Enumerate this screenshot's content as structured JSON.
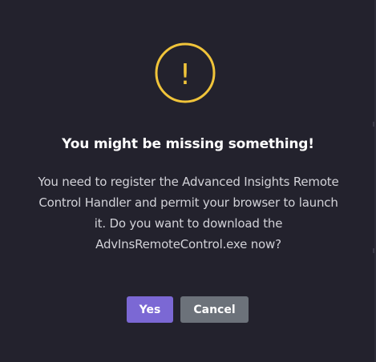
{
  "dialog": {
    "icon": "warning-circle-icon",
    "icon_glyph": "!",
    "icon_color": "#f0c43a",
    "title": "You might be missing something!",
    "message": "You need to register the Advanced Insights Remote Control Handler and permit your browser to launch it. Do you want to download the AdvInsRemoteControl.exe now?",
    "buttons": {
      "yes_label": "Yes",
      "cancel_label": "Cancel"
    },
    "colors": {
      "background": "#23222d",
      "yes_button": "#7b68d4",
      "cancel_button": "#6c727a"
    }
  }
}
